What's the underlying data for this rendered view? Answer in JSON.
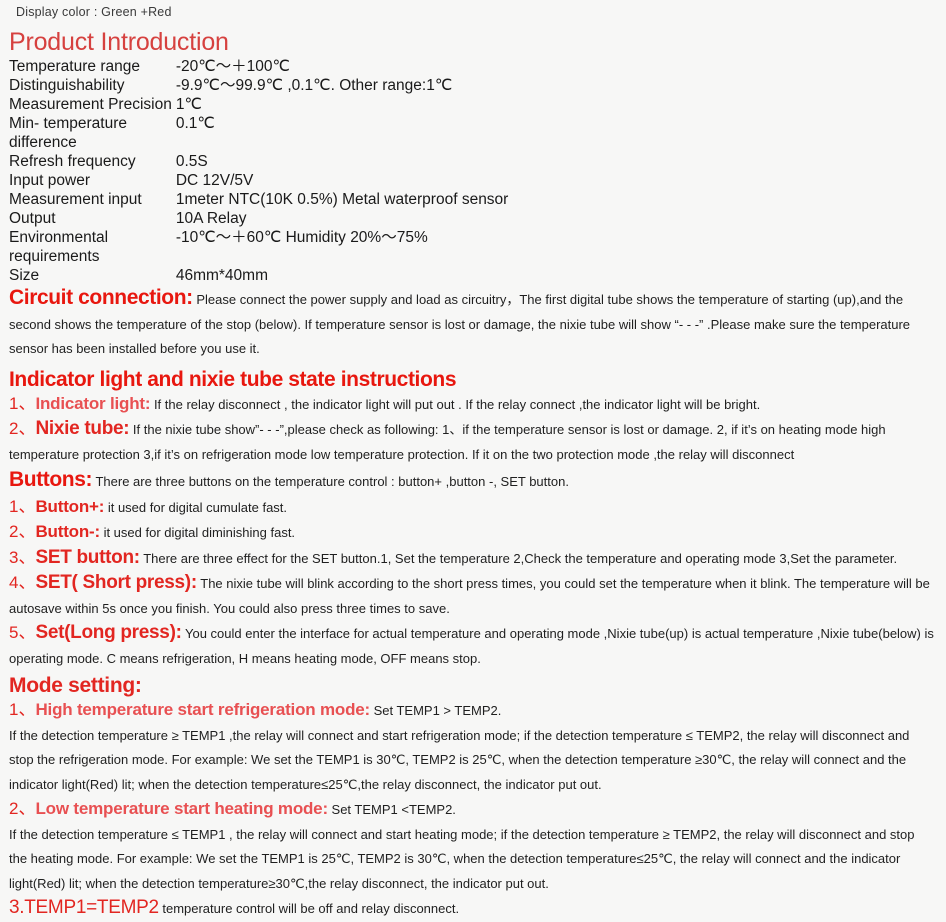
{
  "header": {
    "display_color": "Display color : Green +Red"
  },
  "product_introduction": {
    "title": "Product Introduction",
    "specs": [
      {
        "label": "Temperature range",
        "value": "-20℃～＋100℃"
      },
      {
        "label": "Distinguishability",
        "value": "-9.9℃～99.9℃ ,0.1℃. Other range:1℃"
      },
      {
        "label": "Measurement Precision",
        "value": "1℃"
      },
      {
        "label": "Min- temperature difference",
        "value": "0.1℃"
      },
      {
        "label": "Refresh frequency",
        "value": "0.5S"
      },
      {
        "label": "Input power",
        "value": "DC 12V/5V"
      },
      {
        "label": "Measurement input",
        "value": "1meter NTC(10K 0.5%) Metal waterproof sensor"
      },
      {
        "label": "Output",
        "value": "10A Relay"
      },
      {
        "label": "Environmental requirements",
        "value": "-10℃～＋60℃ Humidity 20%～75%"
      },
      {
        "label": "Size",
        "value": "46mm*40mm"
      }
    ]
  },
  "circuit_connection": {
    "heading": "Circuit connection:",
    "body": "Please connect the power supply and load as circuitry，The first digital tube shows the temperature of starting (up),and the second shows the temperature of the stop (below). If temperature sensor is lost or damage, the nixie tube will show “- - -” .Please make sure the temperature sensor has been installed before you use it."
  },
  "indicator_section": {
    "heading": "Indicator light and nixie tube state instructions",
    "items": [
      {
        "num": "1、",
        "label": "Indicator light:",
        "body": "If the relay disconnect , the indicator light will put out . If the relay connect ,the indicator light will be bright."
      },
      {
        "num": "2、",
        "label": "Nixie tube:",
        "body": "If the nixie tube show”- - -”,please check as following: 1、if the temperature sensor is lost or damage. 2, if it’s on heating mode high temperature protection 3,if it’s on refrigeration mode low temperature protection. If it on the two protection mode ,the relay will disconnect"
      }
    ]
  },
  "buttons_section": {
    "heading": "Buttons:",
    "heading_body": "There are three buttons on the temperature control : button+ ,button -, SET button.",
    "items": [
      {
        "num": "1、",
        "label": "Button+:",
        "body": "it used for digital cumulate fast."
      },
      {
        "num": "2、",
        "label": "Button-:",
        "body": "it used for digital diminishing fast."
      },
      {
        "num": "3、",
        "label": "SET button:",
        "body": "There are three effect for the SET button.1, Set the temperature 2,Check the temperature and operating mode 3,Set the parameter."
      },
      {
        "num": "4、",
        "label": "SET( Short press):",
        "body": "The nixie tube will blink according to the short press times, you could set the temperature when it blink. The temperature will be autosave within 5s once you finish. You could also press three times to save."
      },
      {
        "num": "5、",
        "label": "Set(Long press):",
        "body": "You could enter the interface for actual temperature and operating mode ,Nixie tube(up) is actual temperature ,Nixie tube(below) is operating mode. C means refrigeration, H means heating mode, OFF means stop."
      }
    ]
  },
  "mode_setting": {
    "heading": "Mode setting:",
    "items": [
      {
        "num": "1、",
        "label": "High temperature start refrigeration mode:",
        "inline": "Set TEMP1 > TEMP2.",
        "body": "If the detection temperature ≥ TEMP1 ,the relay will connect and start refrigeration mode; if the detection temperature ≤ TEMP2, the relay will disconnect and stop the refrigeration mode. For example: We set the TEMP1 is 30℃, TEMP2 is 25℃, when the detection temperature ≥30℃, the relay will connect and the indicator light(Red) lit; when the detection temperature≤25℃,the relay disconnect, the indicator put out."
      },
      {
        "num": "2、",
        "label": "Low temperature start heating mode:",
        "inline": "Set TEMP1 <TEMP2.",
        "body": "If the detection temperature ≤ TEMP1 , the relay will connect and start heating mode; if the detection temperature ≥ TEMP2, the relay will disconnect and stop the heating mode. For example: We set the TEMP1 is 25℃, TEMP2 is 30℃, when the detection temperature≤25℃, the relay will connect and the indicator light(Red) lit; when the detection temperature≥30℃,the relay disconnect, the indicator put out."
      }
    ],
    "final": {
      "label": "3.TEMP1=TEMP2",
      "body": "temperature control will be off and relay disconnect."
    }
  },
  "colors": {
    "heading_red_light": "#d6413f",
    "heading_red_bold": "#e8170f",
    "sub_red": "#e22621",
    "body_text": "#1f1f1f",
    "page_bg": "#f7f7f6"
  }
}
